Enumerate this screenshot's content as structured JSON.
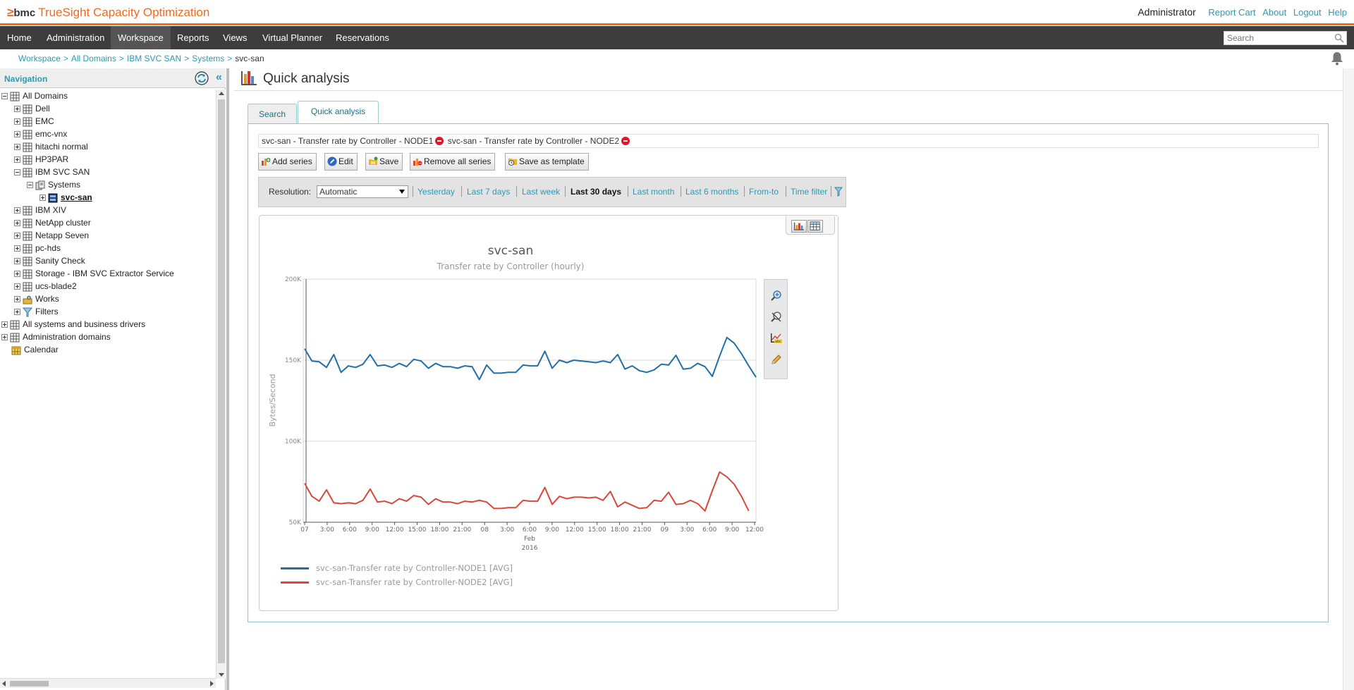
{
  "app": {
    "brand_mark": "≥",
    "brand_bmc": "bmc",
    "brand_product": "TrueSight Capacity Optimization"
  },
  "header": {
    "user": "Administrator",
    "links": [
      "Report Cart",
      "About",
      "Logout",
      "Help"
    ]
  },
  "menu": {
    "items": [
      "Home",
      "Administration",
      "Workspace",
      "Reports",
      "Views",
      "Virtual Planner",
      "Reservations"
    ],
    "active": "Workspace",
    "search_placeholder": "Search"
  },
  "breadcrumb": {
    "links": [
      "Workspace",
      "All Domains",
      "IBM SVC SAN",
      "Systems"
    ],
    "separator": ">",
    "current": "svc-san"
  },
  "navigation": {
    "title": "Navigation",
    "collapse": "«",
    "tree": [
      {
        "label": "All Domains",
        "level": 0,
        "expander": "minus",
        "icon": "domain-grid-icon"
      },
      {
        "label": "Dell",
        "level": 1,
        "expander": "plus",
        "icon": "domain-grid-icon"
      },
      {
        "label": "EMC",
        "level": 1,
        "expander": "plus",
        "icon": "domain-grid-icon"
      },
      {
        "label": "emc-vnx",
        "level": 1,
        "expander": "plus",
        "icon": "domain-grid-icon"
      },
      {
        "label": "hitachi normal",
        "level": 1,
        "expander": "plus",
        "icon": "domain-grid-icon"
      },
      {
        "label": "HP3PAR",
        "level": 1,
        "expander": "plus",
        "icon": "domain-grid-icon"
      },
      {
        "label": "IBM SVC SAN",
        "level": 1,
        "expander": "minus",
        "icon": "domain-grid-icon"
      },
      {
        "label": "Systems",
        "level": 2,
        "expander": "minus",
        "icon": "systems-icon"
      },
      {
        "label": "svc-san",
        "level": 3,
        "expander": "plus",
        "icon": "san-system-icon",
        "selected": true
      },
      {
        "label": "IBM XIV",
        "level": 1,
        "expander": "plus",
        "icon": "domain-grid-icon"
      },
      {
        "label": "NetApp cluster",
        "level": 1,
        "expander": "plus",
        "icon": "domain-grid-icon"
      },
      {
        "label": "Netapp Seven",
        "level": 1,
        "expander": "plus",
        "icon": "domain-grid-icon"
      },
      {
        "label": "pc-hds",
        "level": 1,
        "expander": "plus",
        "icon": "domain-grid-icon"
      },
      {
        "label": "Sanity Check",
        "level": 1,
        "expander": "plus",
        "icon": "domain-grid-icon"
      },
      {
        "label": "Storage - IBM SVC Extractor Service",
        "level": 1,
        "expander": "plus",
        "icon": "domain-grid-icon"
      },
      {
        "label": "ucs-blade2",
        "level": 1,
        "expander": "plus",
        "icon": "domain-grid-icon"
      },
      {
        "label": "Works",
        "level": 1,
        "expander": "plus",
        "icon": "works-icon"
      },
      {
        "label": "Filters",
        "level": 1,
        "expander": "plus",
        "icon": "filter-funnel-icon"
      },
      {
        "label": "All systems and business drivers",
        "level": 0,
        "expander": "plus",
        "icon": "domain-grid-icon"
      },
      {
        "label": "Administration domains",
        "level": 0,
        "expander": "plus",
        "icon": "domain-grid-icon"
      },
      {
        "label": "Calendar",
        "level": 0,
        "expander": "none",
        "icon": "calendar-icon"
      }
    ]
  },
  "main": {
    "title": "Quick analysis",
    "tabs": [
      "Search",
      "Quick analysis"
    ],
    "active_tab": "Quick analysis",
    "series": [
      "svc-san - Transfer rate by Controller - NODE1",
      "svc-san - Transfer rate by Controller - NODE2"
    ],
    "toolbar": {
      "add_series": "Add series",
      "edit": "Edit",
      "save": "Save",
      "remove_all": "Remove all series",
      "save_template": "Save as template"
    },
    "resolution": {
      "label": "Resolution:",
      "selected": "Automatic",
      "ranges": [
        "Yesterday",
        "Last 7 days",
        "Last week",
        "Last 30 days",
        "Last month",
        "Last 6 months",
        "From-to",
        "Time filter"
      ],
      "active_range": "Last 30 days"
    }
  },
  "colors": {
    "accent": "#f06a21",
    "link": "#2a9ab5",
    "node1": "#1f6fa8",
    "node2": "#d9473a"
  },
  "chart_data": {
    "type": "line",
    "title": "svc-san",
    "subtitle": "Transfer rate by Controller (hourly)",
    "ylabel": "Bytes/Second",
    "ylim": [
      50000,
      200000
    ],
    "yticks": [
      50000,
      100000,
      150000,
      200000
    ],
    "ytick_labels": [
      "50K",
      "100K",
      "150K",
      "200K"
    ],
    "xticks": [
      "07",
      "3:00",
      "6:00",
      "9:00",
      "12:00",
      "15:00",
      "18:00",
      "21:00",
      "08",
      "3:00",
      "6:00",
      "9:00",
      "12:00",
      "15:00",
      "18:00",
      "21:00",
      "09",
      "3:00",
      "6:00",
      "9:00",
      "12:00"
    ],
    "x_sublabels": [
      "Feb",
      "2016"
    ],
    "grid": true,
    "legend_position": "bottom-left",
    "series": [
      {
        "name": "svc-san-Transfer rate by Controller-NODE1 [AVG]",
        "values": [
          157000,
          149500,
          149000,
          145500,
          153500,
          142500,
          146500,
          145500,
          147500,
          153500,
          146500,
          147000,
          145500,
          148000,
          146000,
          150500,
          149500,
          145000,
          148000,
          146000,
          146000,
          145000,
          146500,
          146000,
          138000,
          147000,
          142000,
          142000,
          142500,
          142500,
          147000,
          146500,
          146500,
          155500,
          145000,
          150000,
          148500,
          150000,
          149500,
          149000,
          148500,
          149500,
          148500,
          153500,
          144500,
          146500,
          143500,
          142500,
          144000,
          147500,
          147000,
          153000,
          144500,
          145000,
          148000,
          146000,
          140000,
          152500,
          164000,
          160500,
          154000,
          146500,
          139500
        ]
      },
      {
        "name": "svc-san-Transfer rate by Controller-NODE2 [AVG]",
        "values": [
          74000,
          66000,
          63000,
          70000,
          62000,
          61500,
          62000,
          61500,
          63500,
          70500,
          62500,
          63000,
          61500,
          64500,
          63000,
          66500,
          65500,
          61000,
          64500,
          62500,
          62500,
          61500,
          63000,
          62500,
          63500,
          62500,
          58500,
          58500,
          59000,
          59000,
          63500,
          63000,
          63000,
          71500,
          61000,
          66000,
          64500,
          65500,
          65500,
          65000,
          65500,
          63500,
          69000,
          59500,
          62500,
          60500,
          58500,
          59000,
          63500,
          63000,
          68500,
          61000,
          61500,
          63500,
          61500,
          57000,
          69500,
          81000,
          78000,
          73500,
          66000,
          57000
        ]
      }
    ]
  }
}
